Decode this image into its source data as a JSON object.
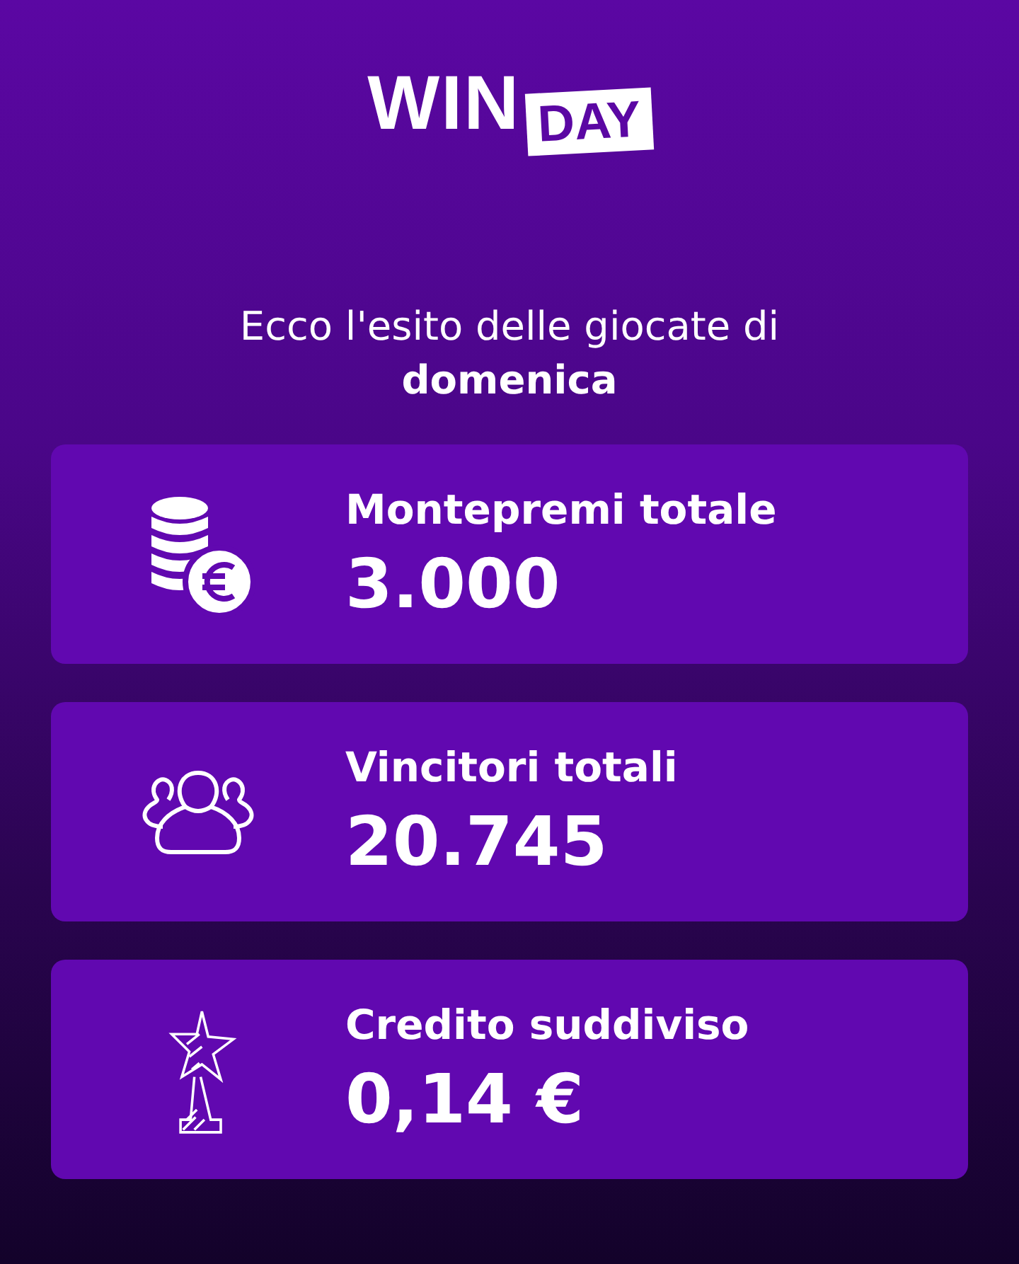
{
  "logo": {
    "part_1": "WIN",
    "part_2": "DAY"
  },
  "subtitle": "Ecco l'esito delle giocate di **domenica**",
  "cards": [
    {
      "kind": "coins",
      "title": "Montepremi totale",
      "value": "3.000"
    },
    {
      "kind": "people",
      "title": "Vincitori totali",
      "value": "20.745"
    },
    {
      "kind": "trophy",
      "title": "Credito suddiviso",
      "value": "0,14 €"
    }
  ]
}
